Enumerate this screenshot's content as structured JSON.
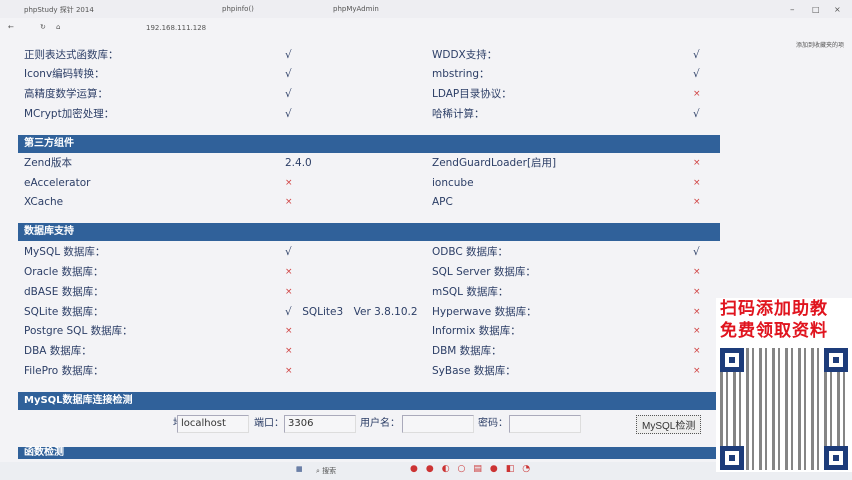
{
  "browser": {
    "tabs": [
      "phpStudy 探针 2014",
      "phpinfo()",
      "phpMyAdmin"
    ],
    "address": "192.168.111.128",
    "bookmark_right": "添加到收藏夹的项"
  },
  "sections": [
    {
      "rows": [
        [
          "正则表达式函数库：",
          "√",
          "WDDX支持：",
          "√"
        ],
        [
          "Iconv编码转换：",
          "√",
          "mbstring：",
          "√"
        ],
        [
          "高精度数学运算：",
          "√",
          "LDAP目录协议：",
          "×"
        ],
        [
          "MCrypt加密处理：",
          "√",
          "哈稀计算：",
          "√"
        ]
      ]
    },
    {
      "title": "第三方组件",
      "rows": [
        [
          "Zend版本",
          "2.4.0",
          "ZendGuardLoader[启用]",
          "×"
        ],
        [
          "eAccelerator",
          "×",
          "ioncube",
          "×"
        ],
        [
          "XCache",
          "×",
          "APC",
          "×"
        ]
      ]
    },
    {
      "title": "数据库支持",
      "rows": [
        [
          "MySQL 数据库：",
          "√",
          "ODBC 数据库：",
          "√"
        ],
        [
          "Oracle 数据库：",
          "×",
          "SQL Server 数据库：",
          "×"
        ],
        [
          "dBASE 数据库：",
          "×",
          "mSQL 数据库：",
          "×"
        ],
        [
          "SQLite 数据库：",
          "√　SQLite3　Ver 3.8.10.2",
          "Hyperwave 数据库：",
          "×"
        ],
        [
          "Postgre SQL 数据库：",
          "×",
          "Informix 数据库：",
          "×"
        ],
        [
          "DBA 数据库：",
          "×",
          "DBM 数据库：",
          "×"
        ],
        [
          "FilePro 数据库：",
          "×",
          "SyBase 数据库：",
          "×"
        ]
      ]
    }
  ],
  "mysql_check": {
    "title": "MySQL数据库连接检测",
    "host_label": "地址：",
    "host_value": "localhost",
    "port_label": "端口：",
    "port_value": "3306",
    "user_label": "用户名：",
    "user_value": "",
    "pass_label": "密码：",
    "pass_value": "",
    "button": "MySQL检测"
  },
  "next_section": "函数检测",
  "taskbar": {
    "search": "搜索"
  },
  "ad": {
    "line1": "扫码添加助教",
    "line2": "免费领取资料"
  }
}
